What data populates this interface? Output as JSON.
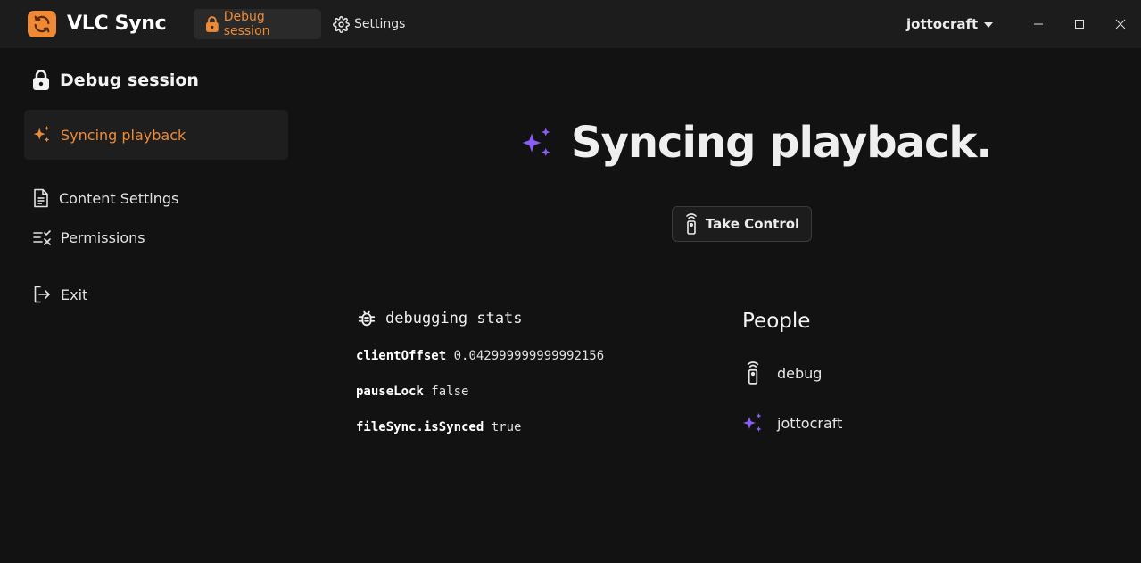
{
  "app": {
    "title": "VLC Sync",
    "icon": "sync-icon",
    "accent": "#ee8a35"
  },
  "nav": {
    "debug_session": "Debug session",
    "settings": "Settings"
  },
  "user": {
    "name": "jottocraft"
  },
  "window_controls": [
    "minimize-icon",
    "maximize-icon",
    "close-icon"
  ],
  "sidebar": {
    "title": "Debug session",
    "items": [
      {
        "label": "Syncing playback",
        "icon": "sparkles-icon",
        "active": true
      },
      {
        "label": "Content Settings",
        "icon": "document-icon"
      },
      {
        "label": "Permissions",
        "icon": "permissions-icon"
      },
      {
        "label": "Exit",
        "icon": "exit-icon"
      }
    ]
  },
  "main": {
    "title": "Syncing playback.",
    "title_icon_color": "#8b5cf6",
    "take_control": "Take Control",
    "stats": {
      "title": "debugging stats",
      "rows": [
        {
          "key": "clientOffset",
          "value": "0.042999999999992156"
        },
        {
          "key": "pauseLock",
          "value": "false"
        },
        {
          "key": "fileSync.isSynced",
          "value": "true"
        }
      ]
    },
    "people": {
      "title": "People",
      "list": [
        {
          "name": "debug",
          "icon": "remote-icon"
        },
        {
          "name": "jottocraft",
          "icon": "sparkles-icon"
        }
      ]
    }
  }
}
